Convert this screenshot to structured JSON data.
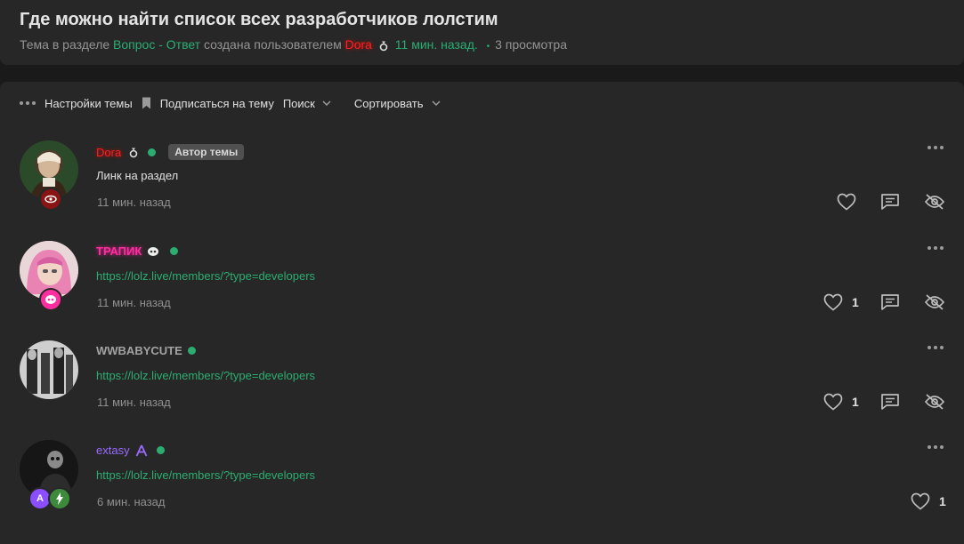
{
  "thread": {
    "title": "Где можно найти список всех разработчиков лолстим",
    "meta_prefix": "Тема в разделе",
    "section": "Вопрос - Ответ",
    "created_by": "создана пользователем",
    "author": "Dora",
    "time": "11 мин. назад.",
    "separator": "•",
    "views": "3 просмотра"
  },
  "toolbar": {
    "settings": "Настройки темы",
    "subscribe": "Подписаться на тему",
    "search": "Поиск",
    "sort": "Сортировать"
  },
  "posts": [
    {
      "username": "Dora",
      "username_color": "#ff1f1f",
      "badge": "Автор темы",
      "content": "Линк на раздел",
      "time": "11 мин. назад",
      "likes": ""
    },
    {
      "username": "ТРАПИК",
      "username_color": "#ff2ea0",
      "content": "https://lolz.live/members/?type=developers",
      "time": "11 мин. назад",
      "likes": "1"
    },
    {
      "username": "WWBABYCUTE",
      "username_color": "#a3a3a3",
      "content": "https://lolz.live/members/?type=developers",
      "time": "11 мин. назад",
      "likes": "1"
    },
    {
      "username": "extasy",
      "username_color": "#9a6bff",
      "content": "https://lolz.live/members/?type=developers",
      "time": "6 мин. назад",
      "likes": "1"
    }
  ],
  "colors": {
    "accent_green": "#2bad72",
    "background": "#1a1a1a",
    "card": "#272727"
  }
}
